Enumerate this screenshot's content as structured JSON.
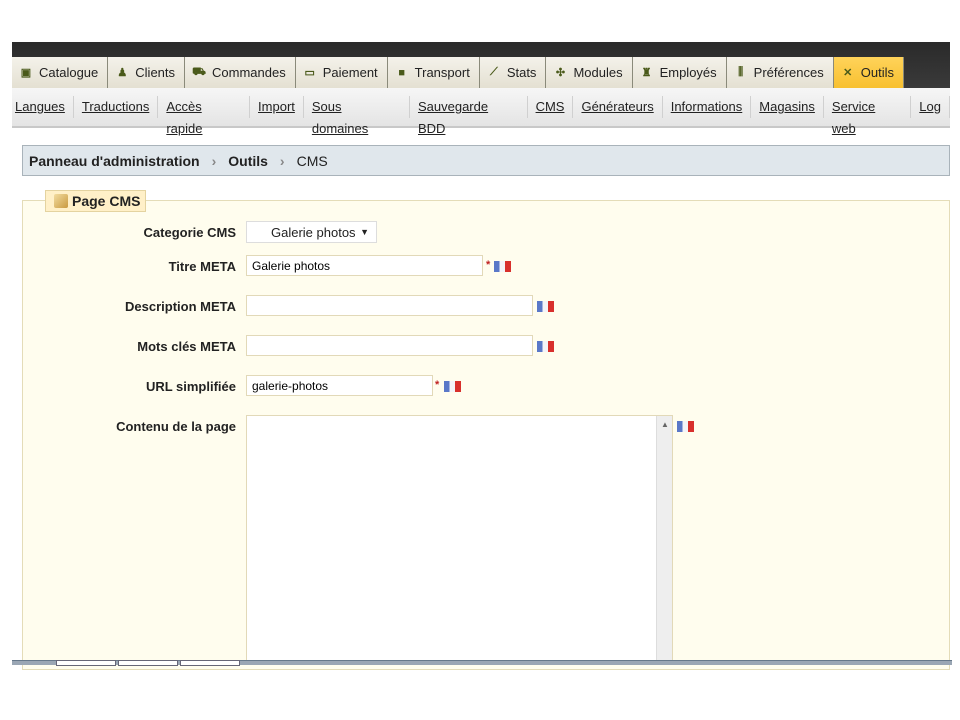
{
  "tabs": [
    {
      "label": "Catalogue",
      "icon": "book-icon"
    },
    {
      "label": "Clients",
      "icon": "user-icon"
    },
    {
      "label": "Commandes",
      "icon": "cart-icon"
    },
    {
      "label": "Paiement",
      "icon": "card-icon"
    },
    {
      "label": "Transport",
      "icon": "truck-icon"
    },
    {
      "label": "Stats",
      "icon": "chart-icon"
    },
    {
      "label": "Modules",
      "icon": "puzzle-icon"
    },
    {
      "label": "Employés",
      "icon": "group-icon"
    },
    {
      "label": "Préférences",
      "icon": "sliders-icon"
    },
    {
      "label": "Outils",
      "icon": "tools-icon",
      "active": true
    }
  ],
  "subnav": [
    "Langues",
    "Traductions",
    "Accès rapide",
    "Import",
    "Sous domaines",
    "Sauvegarde BDD",
    "CMS",
    "Générateurs",
    "Informations",
    "Magasins",
    "Service web",
    "Log"
  ],
  "breadcrumb": {
    "root": "Panneau d'administration",
    "section": "Outils",
    "current": "CMS"
  },
  "form": {
    "legend": "Page CMS",
    "category_label": "Categorie CMS",
    "category_value": "Galerie photos",
    "meta_title_label": "Titre META",
    "meta_title_value": "Galerie photos",
    "meta_desc_label": "Description META",
    "meta_desc_value": "",
    "meta_keywords_label": "Mots clés META",
    "meta_keywords_value": "",
    "url_label": "URL simplifiée",
    "url_value": "galerie-photos",
    "content_label": "Contenu de la page",
    "required_mark": "*"
  }
}
